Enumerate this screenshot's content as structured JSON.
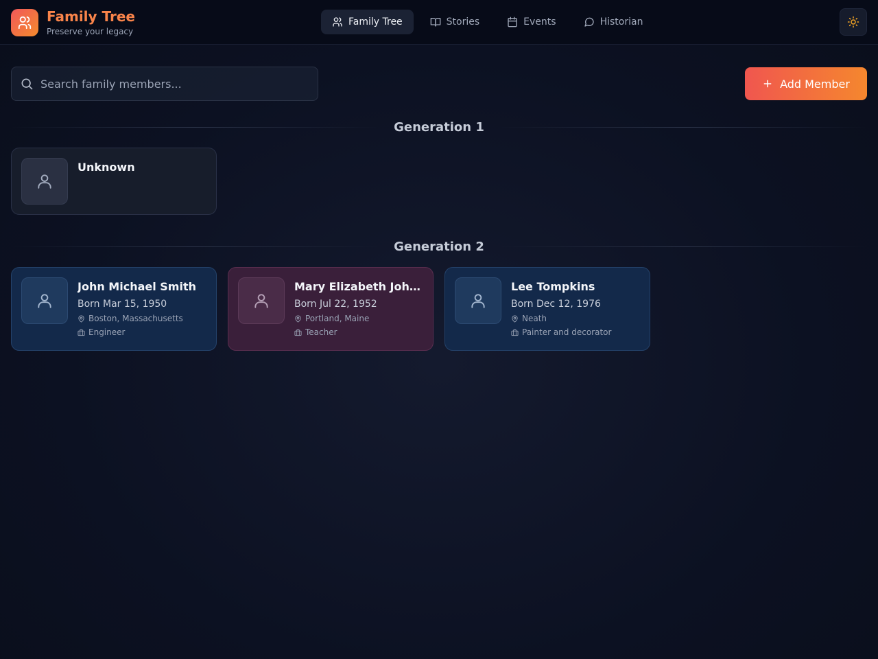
{
  "brand": {
    "title": "Family Tree",
    "subtitle": "Preserve your legacy",
    "icon": "users-icon",
    "gradient": [
      "#f0585a",
      "#f58b2d"
    ]
  },
  "nav": {
    "tabs": [
      {
        "label": "Family Tree",
        "icon": "users-icon",
        "active": true
      },
      {
        "label": "Stories",
        "icon": "book-open-icon",
        "active": false
      },
      {
        "label": "Events",
        "icon": "calendar-icon",
        "active": false
      },
      {
        "label": "Historian",
        "icon": "message-circle-icon",
        "active": false
      }
    ],
    "theme_toggle_icon": "sun-icon"
  },
  "search": {
    "placeholder": "Search family members...",
    "value": ""
  },
  "add_member": {
    "label": "Add Member",
    "icon": "plus-icon"
  },
  "generations": [
    {
      "heading": "Generation 1",
      "members": [
        {
          "name": "Unknown",
          "born": "",
          "location": "",
          "occupation": "",
          "color": "neutral"
        }
      ]
    },
    {
      "heading": "Generation 2",
      "members": [
        {
          "name": "John Michael Smith",
          "born": "Born Mar 15, 1950",
          "location": "Boston, Massachusetts",
          "occupation": "Engineer",
          "color": "blue"
        },
        {
          "name": "Mary Elizabeth Johnson",
          "born": "Born Jul 22, 1952",
          "location": "Portland, Maine",
          "occupation": "Teacher",
          "color": "pink"
        },
        {
          "name": "Lee Tompkins",
          "born": "Born Dec 12, 1976",
          "location": "Neath",
          "occupation": "Painter and decorator",
          "color": "blue"
        }
      ]
    }
  ],
  "colors": {
    "accent": "#f9844a",
    "background": "#0c1122",
    "male_card": "#13294a",
    "female_card": "#3a1f3a"
  }
}
